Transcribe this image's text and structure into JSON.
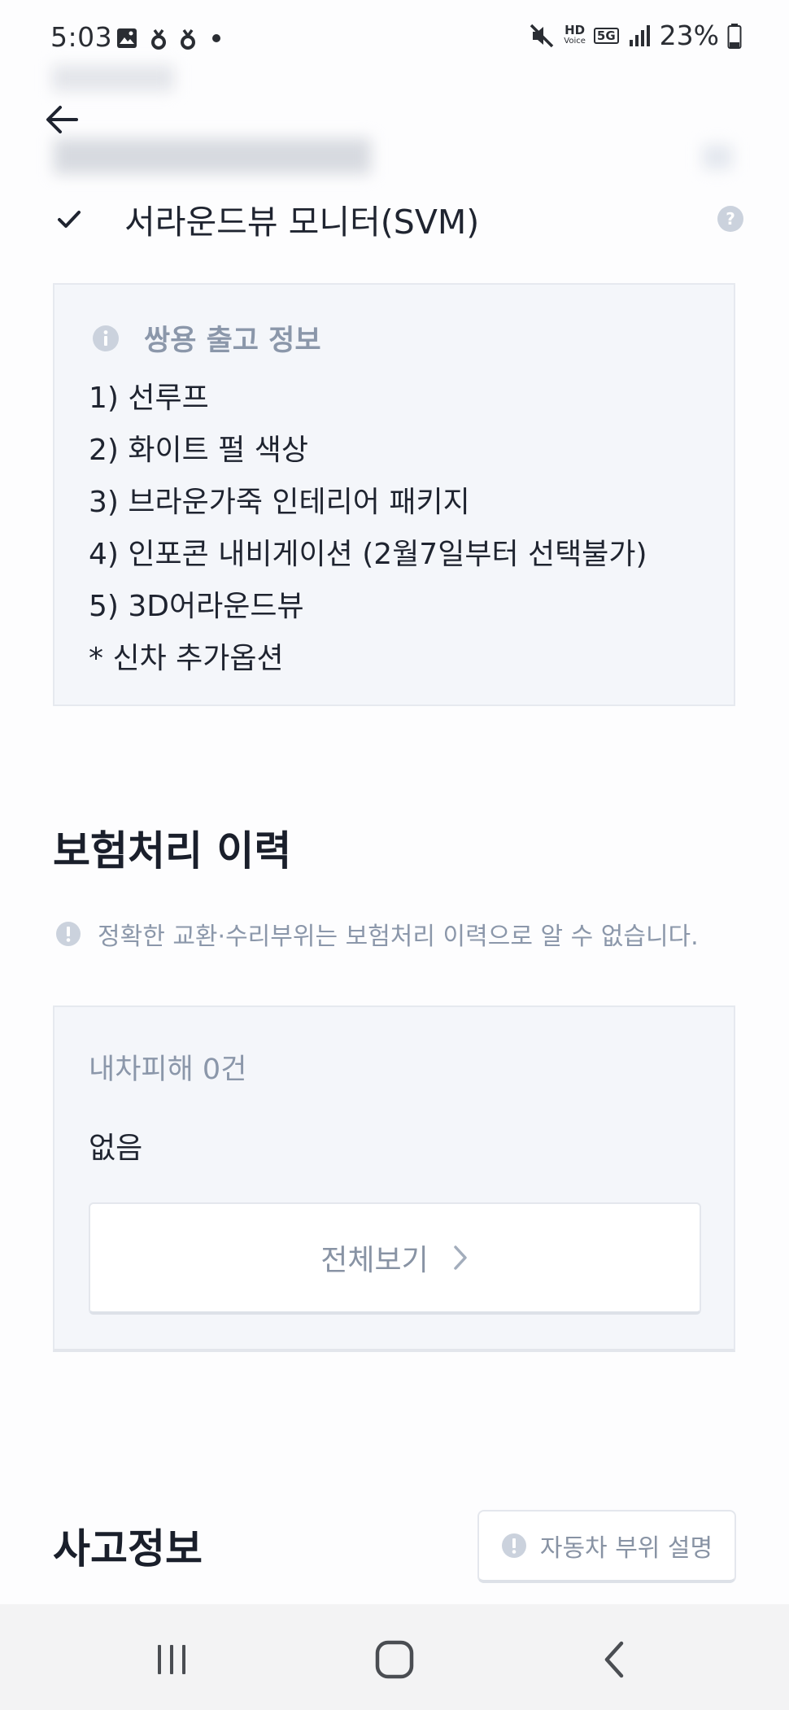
{
  "status_bar": {
    "time": "5:03",
    "left_icons": [
      "gallery-icon",
      "notification-icon",
      "notification-icon",
      "dot-icon"
    ],
    "right_icons": [
      "mute-icon",
      "hd-voice-icon",
      "5g-icon",
      "signal-icon",
      "battery-icon"
    ],
    "hd_voice_top": "HD",
    "hd_voice_bottom": "Voice",
    "network": "5G",
    "battery": "23%"
  },
  "option": {
    "label": "서라운드뷰 모니터(SVM)",
    "checked": true
  },
  "info_box": {
    "title": "쌍용 출고 정보",
    "lines": [
      "1) 선루프",
      "2) 화이트 펄 색상",
      "3) 브라운가죽 인테리어 패키지",
      "4) 인포콘 내비게이션 (2월7일부터 선택불가)",
      "5) 3D어라운드뷰",
      "* 신차 추가옵션"
    ]
  },
  "insurance": {
    "title": "보험처리 이력",
    "notice": "정확한 교환·수리부위는 보험처리 이력으로 알 수 없습니다.",
    "damage_label": "내차피해 0건",
    "damage_value": "없음",
    "view_all": "전체보기"
  },
  "accident": {
    "title": "사고정보",
    "parts_button": "자동차 부위 설명"
  },
  "colors": {
    "accent_gray": "#8b97aa",
    "box_bg": "#f4f6fa",
    "text_dark": "#1f2430"
  }
}
